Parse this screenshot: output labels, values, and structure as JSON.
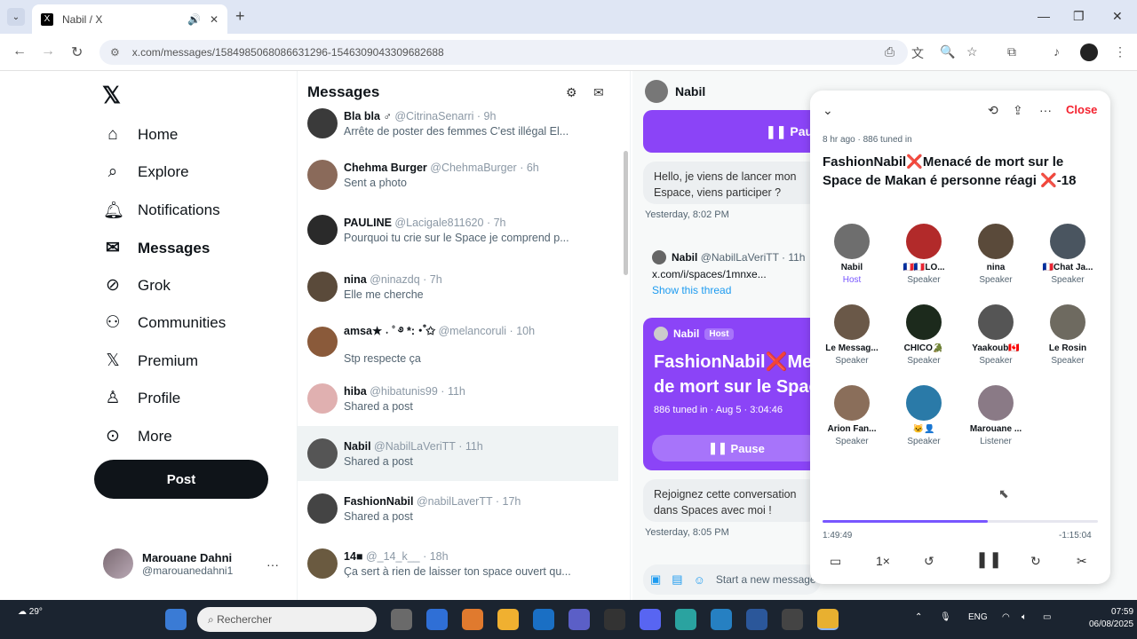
{
  "browser": {
    "tab_title": "Nabil / X",
    "url": "x.com/messages/1584985068086631296-1546309043309682688"
  },
  "nav": {
    "items": [
      "Home",
      "Explore",
      "Notifications",
      "Messages",
      "Grok",
      "Communities",
      "Premium",
      "Profile",
      "More"
    ],
    "post_label": "Post",
    "me_name": "Marouane Dahni",
    "me_handle": "@marouanedahni1"
  },
  "messages": {
    "title": "Messages",
    "conversations": [
      {
        "name": "Bla bla ♂",
        "handle": "@CitrinaSenarri",
        "time": "9h",
        "preview": "Arrête de poster des femmes C'est illégal El..."
      },
      {
        "name": "Chehma Burger",
        "handle": "@ChehmaBurger",
        "time": "6h",
        "preview": "Sent a photo"
      },
      {
        "name": "PAULINE",
        "handle": "@Lacigale811620",
        "time": "7h",
        "preview": "Pourquoi tu crie sur le Space je comprend p..."
      },
      {
        "name": "nina",
        "handle": "@ninazdq",
        "time": "7h",
        "preview": "Elle me cherche"
      },
      {
        "name": "amsa★ ˖ ˚ ࿔ *:・゚✩",
        "handle": "@melancoruli",
        "time": "10h",
        "preview": "Stp respecte ça"
      },
      {
        "name": "hiba",
        "handle": "@hibatunis99",
        "time": "11h",
        "preview": "Shared a post"
      },
      {
        "name": "Nabil",
        "handle": "@NabilLaVeriTT",
        "time": "11h",
        "preview": "Shared a post"
      },
      {
        "name": "FashionNabil",
        "handle": "@nabilLaverTT",
        "time": "17h",
        "preview": "Shared a post"
      },
      {
        "name": "14■",
        "handle": "@_14_k__",
        "time": "18h",
        "preview": "Ça sert à rien de laisser ton space ouvert qu..."
      }
    ]
  },
  "chat": {
    "name": "Nabil",
    "pause_top": "Pause",
    "bubble1": "Hello, je viens de lancer mon Espace, viens participer ?",
    "ts1": "Yesterday, 8:02 PM",
    "link_name": "Nabil",
    "link_handle": "@NabilLaVeriTT · 11h",
    "link_url": "x.com/i/spaces/1mnxe...",
    "show_thread": "Show this thread",
    "card_name": "Nabil",
    "card_badge": "Host",
    "card_title_1": "FashionNabil❌Menacé",
    "card_title_2": "de mort sur le Space",
    "card_info": "886 tuned in · Aug 5 · 3:04:46",
    "card_pause": "Pause",
    "bubble2": "Rejoignez cette conversation dans Spaces avec moi !",
    "ts2": "Yesterday, 8:05 PM",
    "composer_placeholder": "Start a new message"
  },
  "space": {
    "meta": "8 hr ago · 886 tuned in",
    "title": "FashionNabil❌Menacé de mort sur le Space de Makan é personne réagi ❌-18",
    "close_label": "Close",
    "people": [
      {
        "name": "Nabil",
        "role": "Host",
        "color": "#6e6e6e"
      },
      {
        "name": "🇫🇷🇫🇷LO...",
        "role": "Speaker",
        "color": "#b22a2a"
      },
      {
        "name": "nina",
        "role": "Speaker",
        "color": "#5a4a3a"
      },
      {
        "name": "🇫🇷Chat Ja...",
        "role": "Speaker",
        "color": "#4a5560"
      },
      {
        "name": "Le Messag...",
        "role": "Speaker",
        "color": "#6a5848"
      },
      {
        "name": "CHICO🐊",
        "role": "Speaker",
        "color": "#1c2a1c"
      },
      {
        "name": "Yaakoub🇨🇦",
        "role": "Speaker",
        "color": "#555555"
      },
      {
        "name": "Le Rosin",
        "role": "Speaker",
        "color": "#6e6a60"
      },
      {
        "name": "Arion Fan...",
        "role": "Speaker",
        "color": "#8a6e5a"
      },
      {
        "name": "🐱👤",
        "role": "Speaker",
        "color": "#2a7aa8"
      },
      {
        "name": "Marouane ...",
        "role": "Listener",
        "color": "#8a7a86"
      }
    ],
    "elapsed": "1:49:49",
    "remaining": "-1:15:04",
    "progress": 0.6,
    "speed": "1×"
  },
  "taskbar": {
    "temp": "29°",
    "search_placeholder": "Rechercher",
    "lang": "ENG",
    "time": "07:59",
    "date": "06/08/2025"
  }
}
